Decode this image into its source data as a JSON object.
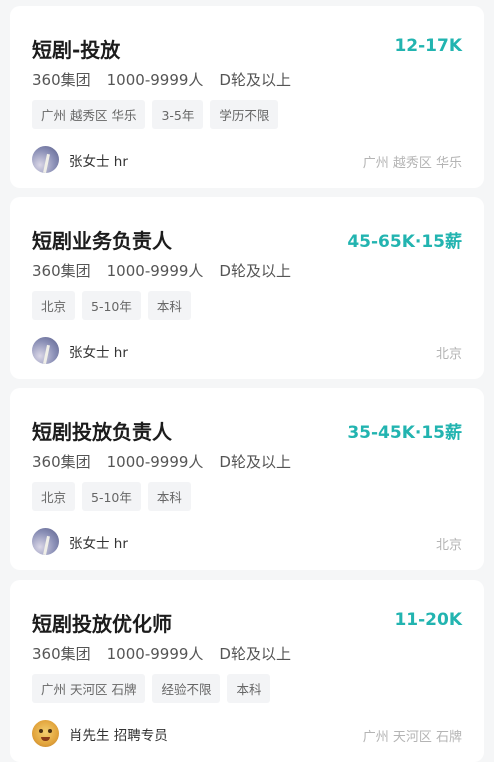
{
  "jobs": [
    {
      "title": "短剧-投放",
      "salary": "12-17K",
      "company": "360集团",
      "size": "1000-9999人",
      "stage": "D轮及以上",
      "tags": [
        "广州 越秀区 华乐",
        "3-5年",
        "学历不限"
      ],
      "recruiter": "张女士 hr",
      "avatar": "sky-avatar",
      "location": "广州 越秀区 华乐"
    },
    {
      "title": "短剧业务负责人",
      "salary": "45-65K·15薪",
      "company": "360集团",
      "size": "1000-9999人",
      "stage": "D轮及以上",
      "tags": [
        "北京",
        "5-10年",
        "本科"
      ],
      "recruiter": "张女士 hr",
      "avatar": "sky-avatar",
      "location": "北京"
    },
    {
      "title": "短剧投放负责人",
      "salary": "35-45K·15薪",
      "company": "360集团",
      "size": "1000-9999人",
      "stage": "D轮及以上",
      "tags": [
        "北京",
        "5-10年",
        "本科"
      ],
      "recruiter": "张女士 hr",
      "avatar": "sky-avatar",
      "location": "北京"
    },
    {
      "title": "短剧投放优化师",
      "salary": "11-20K",
      "company": "360集团",
      "size": "1000-9999人",
      "stage": "D轮及以上",
      "tags": [
        "广州 天河区 石牌",
        "经验不限",
        "本科"
      ],
      "recruiter": "肖先生 招聘专员",
      "avatar": "cartoon-avatar",
      "location": "广州 天河区 石牌"
    }
  ],
  "colors": {
    "salary": "#22b4b0",
    "background": "#f5f6f7",
    "card": "#ffffff"
  }
}
